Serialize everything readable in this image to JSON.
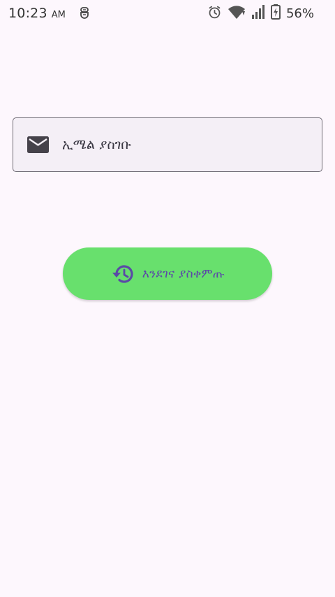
{
  "status_bar": {
    "time": "10:23",
    "ampm": "AM",
    "battery_percent": "56%",
    "icons": [
      "notification-icon",
      "alarm-icon",
      "wifi-icon",
      "signal-icon",
      "battery-icon"
    ]
  },
  "email": {
    "placeholder": "ኢሜል ያስገቡ",
    "value": "",
    "icon": "mail-icon"
  },
  "restore_button": {
    "label": "እንደገና ያስቀምጡ",
    "icon": "restore-history-icon"
  },
  "colors": {
    "background": "#fdf7fd",
    "button": "#68e06d",
    "button_text": "#5a4aa6",
    "field_background": "#f4eff6",
    "field_border": "#6e6a74"
  }
}
